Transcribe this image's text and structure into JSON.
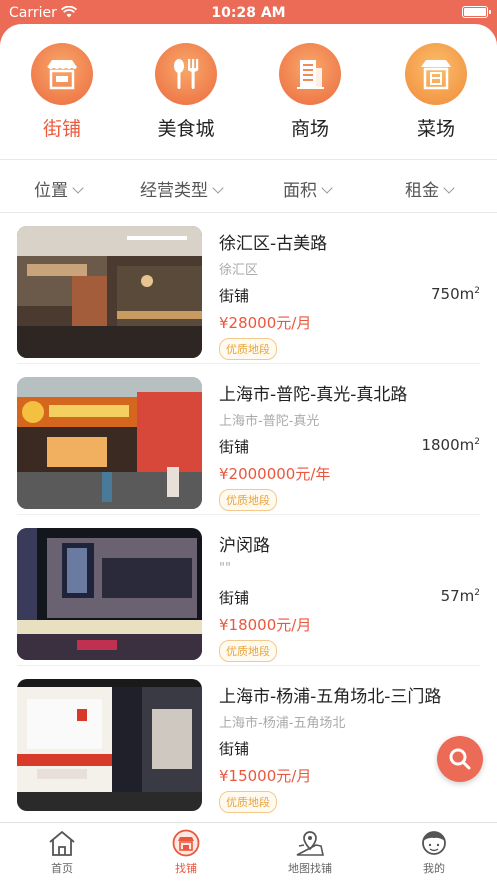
{
  "status_bar": {
    "carrier": "Carrier",
    "time": "10:28 AM"
  },
  "categories": [
    {
      "label": "街铺",
      "icon": "storefront-icon",
      "active": true
    },
    {
      "label": "美食城",
      "icon": "fork-spoon-icon",
      "active": false
    },
    {
      "label": "商场",
      "icon": "building-icon",
      "active": false
    },
    {
      "label": "菜场",
      "icon": "market-stall-icon",
      "active": false
    }
  ],
  "filters": [
    {
      "label": "位置"
    },
    {
      "label": "经营类型"
    },
    {
      "label": "面积"
    },
    {
      "label": "租金"
    }
  ],
  "listings": [
    {
      "title": "徐汇区-古美路",
      "subtitle": "徐汇区",
      "type": "街铺",
      "area": "750m",
      "price": "¥28000元/月",
      "tag": "优质地段"
    },
    {
      "title": "上海市-普陀-真光-真北路",
      "subtitle": "上海市-普陀-真光",
      "type": "街铺",
      "area": "1800m",
      "price": "¥2000000元/年",
      "tag": "优质地段"
    },
    {
      "title": "沪闵路",
      "subtitle": "\"\"",
      "type": "街铺",
      "area": "57m",
      "price": "¥18000元/月",
      "tag": "优质地段"
    },
    {
      "title": "上海市-杨浦-五角场北-三门路",
      "subtitle": "上海市-杨浦-五角场北",
      "type": "街铺",
      "area": "",
      "price": "¥15000元/月",
      "tag": "优质地段"
    }
  ],
  "area_unit_sup": "2",
  "tabs": [
    {
      "label": "首页",
      "icon": "home-icon",
      "active": false
    },
    {
      "label": "找铺",
      "icon": "find-shop-icon",
      "active": true
    },
    {
      "label": "地图找铺",
      "icon": "map-pin-icon",
      "active": false
    },
    {
      "label": "我的",
      "icon": "profile-icon",
      "active": false
    }
  ],
  "colors": {
    "accent": "#ec6b57",
    "price": "#e9573f",
    "tag": "#e8a33a"
  }
}
